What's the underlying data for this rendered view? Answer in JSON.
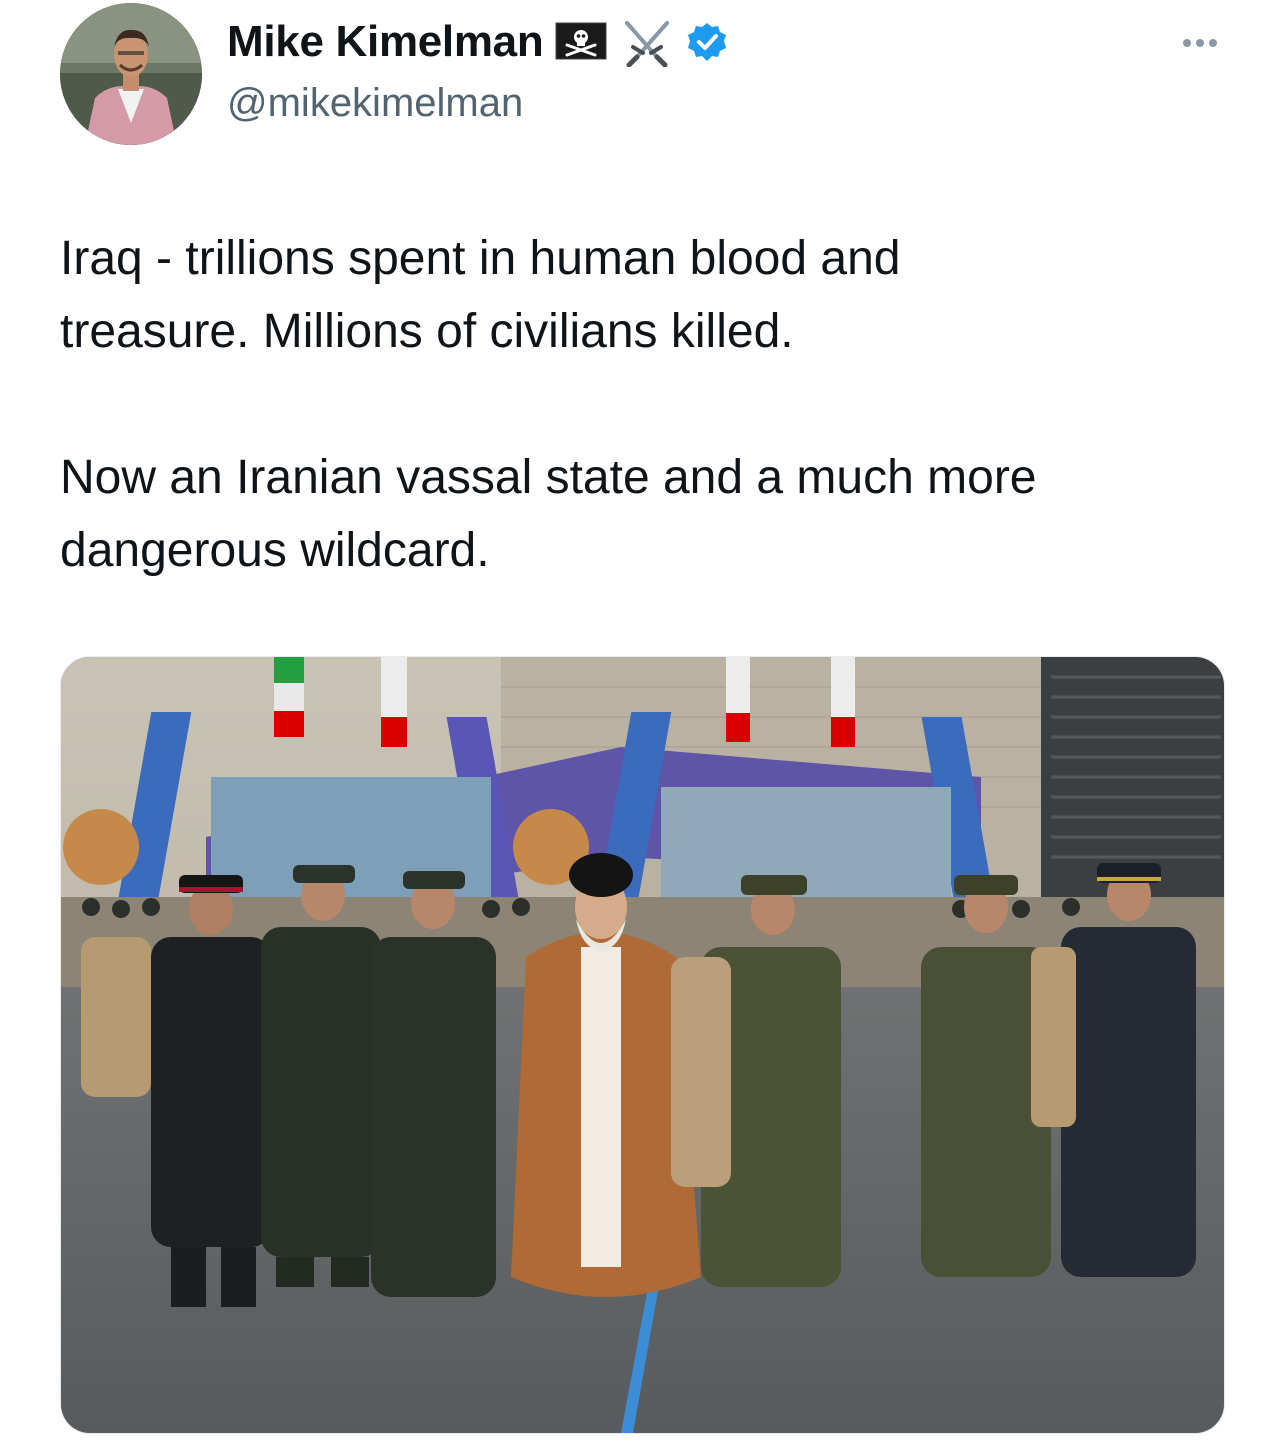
{
  "author": {
    "display_name": "Mike Kimelman",
    "handle": "@mikekimelman",
    "name_emojis": [
      "pirate-flag-icon",
      "crossed-swords-icon"
    ],
    "verified": true,
    "verified_color": "#1d9bf0"
  },
  "tweet": {
    "text": "Iraq - trillions spent in human blood and\ntreasure. Millions of civilians killed.\n\nNow an Iranian vassal state and a much more\ndangerous wildcard."
  },
  "media": {
    "alt": ""
  },
  "colors": {
    "text_primary": "#0f1419",
    "text_secondary": "#536471",
    "accent": "#1d9bf0"
  }
}
